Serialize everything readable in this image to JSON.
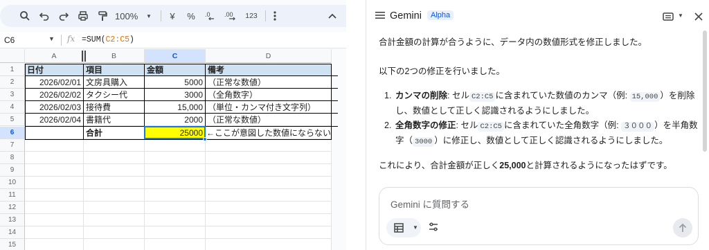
{
  "toolbar": {
    "zoom": "100%",
    "currency_symbol": "¥",
    "percent_symbol": "%",
    "number_format_label": "123"
  },
  "formula_bar": {
    "cell_ref": "C6",
    "formula_prefix": "=SUM(",
    "formula_ref": "C2:C5",
    "formula_suffix": ")"
  },
  "sheet": {
    "columns": [
      "A",
      "B",
      "C",
      "D"
    ],
    "selected_column": "C",
    "rows": [
      "1",
      "2",
      "3",
      "4",
      "5",
      "6",
      "7",
      "8",
      "9",
      "10",
      "11",
      "12",
      "13",
      "14",
      "15"
    ],
    "selected_row": "6",
    "header_row": [
      "日付",
      "項目",
      "金額",
      "備考"
    ],
    "data_rows": [
      [
        "2026/02/01",
        "文房具購入",
        "5000",
        "（正常な数値）"
      ],
      [
        "2026/02/02",
        "タクシー代",
        "3000",
        "（全角数字）"
      ],
      [
        "2026/02/03",
        "接待費",
        "15,000",
        "（単位・カンマ付き文字列）"
      ],
      [
        "2026/02/04",
        "書籍代",
        "2000",
        "（正常な数値）"
      ]
    ],
    "total_row": [
      "",
      "合計",
      "25000",
      "←ここが意図した数値にならない"
    ]
  },
  "gemini": {
    "title": "Gemini",
    "badge": "Alpha",
    "intro": "合計金額の計算が合うように、データ内の数値形式を修正しました。",
    "fixes_lead": "以下の2つの修正を行いました。",
    "fix1": {
      "num": "1.",
      "title": "カンマの削除",
      "t1": ": セル",
      "code1": "C2:C5",
      "t2": "に含まれていた数値のカンマ（例: ",
      "code2": "15,000",
      "t3": "）を削除",
      "line2": "し、数値として正しく認識されるようにしました。"
    },
    "fix2": {
      "num": "2.",
      "title": "全角数字の修正",
      "t1": ": セル",
      "code1": "C2:C5",
      "t2": "に含まれていた全角数字（例: ",
      "code2": "３０００",
      "t3": "）を半角数",
      "line2a": "字（",
      "code3": "3000",
      "line2b": "）に修正し、数値として正しく認識されるようにしました。"
    },
    "conclusion_a": "これにより、合計金額が正しく",
    "conclusion_b": "25,000",
    "conclusion_c": "と計算されるようになったはずです。",
    "input_placeholder": "Gemini に質問する"
  }
}
